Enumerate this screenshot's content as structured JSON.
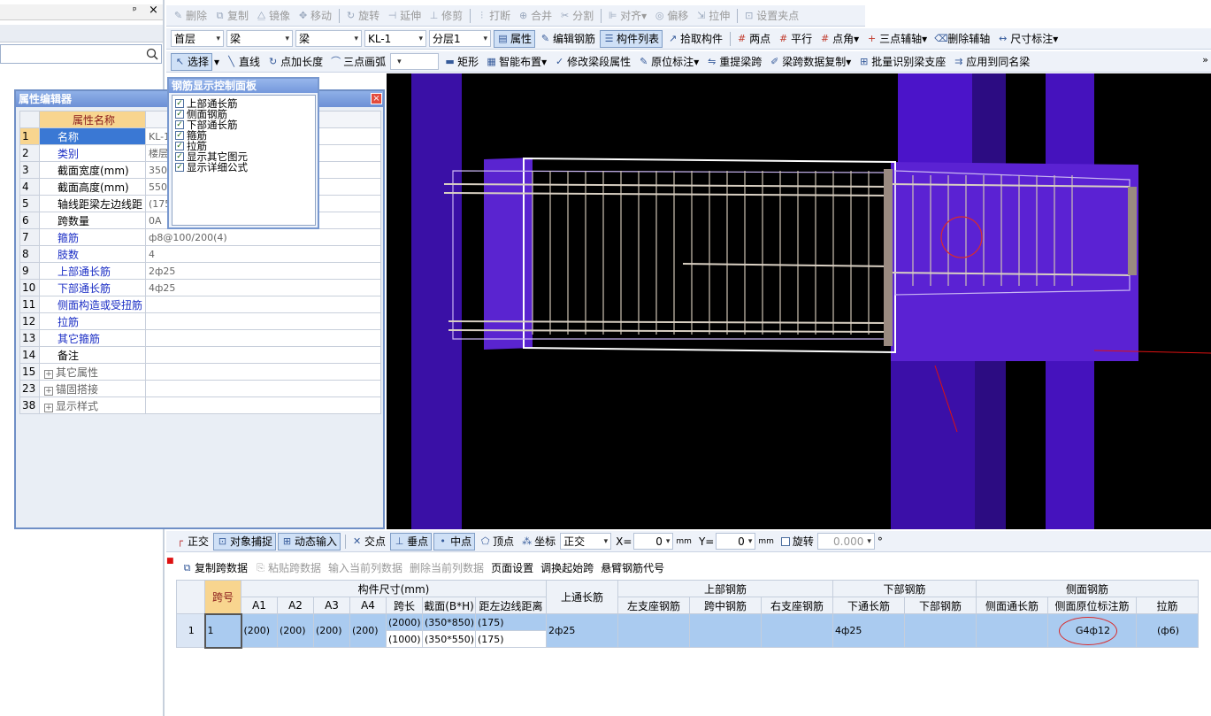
{
  "toolbar1": [
    {
      "label": "删除",
      "icon": "delete-icon",
      "disabled": true
    },
    {
      "label": "复制",
      "icon": "copy-icon",
      "disabled": true
    },
    {
      "label": "镜像",
      "icon": "mirror-icon",
      "disabled": true
    },
    {
      "label": "移动",
      "icon": "move-icon",
      "disabled": true
    },
    {
      "label": "旋转",
      "icon": "rotate-icon",
      "disabled": true
    },
    {
      "label": "延伸",
      "icon": "extend-icon",
      "disabled": true
    },
    {
      "label": "修剪",
      "icon": "trim-icon",
      "disabled": true
    },
    {
      "label": "打断",
      "icon": "break-icon",
      "disabled": true
    },
    {
      "label": "合并",
      "icon": "merge-icon",
      "disabled": true
    },
    {
      "label": "分割",
      "icon": "split-icon",
      "disabled": true
    },
    {
      "label": "对齐",
      "icon": "align-icon",
      "disabled": true
    },
    {
      "label": "偏移",
      "icon": "offset-icon",
      "disabled": true
    },
    {
      "label": "拉伸",
      "icon": "stretch-icon",
      "disabled": true
    },
    {
      "label": "设置夹点",
      "icon": "grip-icon",
      "disabled": true
    }
  ],
  "toolbar2": {
    "selectors": [
      "首层",
      "梁",
      "梁",
      "KL-1",
      "分层1"
    ],
    "buttons": [
      "属性",
      "编辑钢筋",
      "构件列表",
      "拾取构件",
      "两点",
      "平行",
      "点角",
      "三点辅轴",
      "删除辅轴",
      "尺寸标注"
    ]
  },
  "toolbar3": {
    "buttons": [
      "选择",
      "直线",
      "点加长度",
      "三点画弧",
      "矩形",
      "智能布置",
      "修改梁段属性",
      "原位标注",
      "重提梁跨",
      "梁跨数据复制",
      "批量识别梁支座",
      "应用到同名梁"
    ],
    "more": "»"
  },
  "left_pane": {
    "pin": "ᵖ",
    "close": "×",
    "search_icon": "search-icon"
  },
  "property_editor": {
    "title": "属性编辑器",
    "header": "属性名称",
    "rows": [
      {
        "num": "1",
        "name": "名称",
        "value": "KL-1",
        "blue": false
      },
      {
        "num": "2",
        "name": "类别",
        "value": "楼层",
        "blue": true
      },
      {
        "num": "3",
        "name": "截面宽度(mm)",
        "value": "350",
        "blue": false
      },
      {
        "num": "4",
        "name": "截面高度(mm)",
        "value": "550",
        "blue": false
      },
      {
        "num": "5",
        "name": "轴线距梁左边线距",
        "value": "(175",
        "blue": false
      },
      {
        "num": "6",
        "name": "跨数量",
        "value": "0A",
        "blue": false
      },
      {
        "num": "7",
        "name": "箍筋",
        "value": "ф8@100/200(4)",
        "blue": true
      },
      {
        "num": "8",
        "name": "肢数",
        "value": "4",
        "blue": true
      },
      {
        "num": "9",
        "name": "上部通长筋",
        "value": "2ф25",
        "blue": true
      },
      {
        "num": "10",
        "name": "下部通长筋",
        "value": "4ф25",
        "blue": true
      },
      {
        "num": "11",
        "name": "侧面构造或受扭筋",
        "value": "",
        "blue": true
      },
      {
        "num": "12",
        "name": "拉筋",
        "value": "",
        "blue": true
      },
      {
        "num": "13",
        "name": "其它箍筋",
        "value": "",
        "blue": true
      },
      {
        "num": "14",
        "name": "备注",
        "value": "",
        "blue": false
      },
      {
        "num": "15",
        "name": "其它属性",
        "value": "",
        "blue": false,
        "group": true
      },
      {
        "num": "23",
        "name": "锚固搭接",
        "value": "",
        "blue": false,
        "group": true
      },
      {
        "num": "38",
        "name": "显示样式",
        "value": "",
        "blue": false,
        "group": true
      }
    ]
  },
  "control_panel": {
    "title": "钢筋显示控制面板",
    "close": "×",
    "items": [
      "上部通长筋",
      "侧面钢筋",
      "下部通长筋",
      "箍筋",
      "拉筋",
      "显示其它图元",
      "显示详细公式"
    ]
  },
  "status_bar": {
    "items": [
      "正交",
      "对象捕捉",
      "动态输入",
      "交点",
      "垂点",
      "中点",
      "顶点",
      "坐标"
    ],
    "mode": "正交",
    "x_label": "X=",
    "x_value": "0",
    "y_label": "Y=",
    "y_value": "0",
    "unit": "mm",
    "rotate_label": "旋转",
    "rotate_value": "0.000",
    "degree": "°"
  },
  "grid_toolbar": [
    "复制跨数据",
    "粘贴跨数据",
    "输入当前列数据",
    "删除当前列数据",
    "页面设置",
    "调换起始跨",
    "悬臂钢筋代号"
  ],
  "grid": {
    "h_span": "跨号",
    "h_size": "构件尺寸(mm)",
    "h_top_long": "上通长筋",
    "h_top": "上部钢筋",
    "h_bottom": "下部钢筋",
    "h_side": "侧面钢筋",
    "sub": [
      "A1",
      "A2",
      "A3",
      "A4",
      "跨长",
      "截面(B*H)",
      "距左边线距离",
      "左支座钢筋",
      "跨中钢筋",
      "右支座钢筋",
      "下通长筋",
      "下部钢筋",
      "侧面通长筋",
      "侧面原位标注筋",
      "拉筋"
    ],
    "row": {
      "num": "1",
      "span": "1",
      "a1": "(200)",
      "a2": "(200)",
      "a3": "(200)",
      "a4": "(200)",
      "len1": "(2000)",
      "len2": "(1000)",
      "sec1": "(350*850)",
      "sec2": "(350*550)",
      "dist1": "(175)",
      "dist2": "(175)",
      "top_long": "2ф25",
      "bottom_long": "4ф25",
      "side_mark": "G4ф12",
      "tie": "(ф6)"
    }
  }
}
